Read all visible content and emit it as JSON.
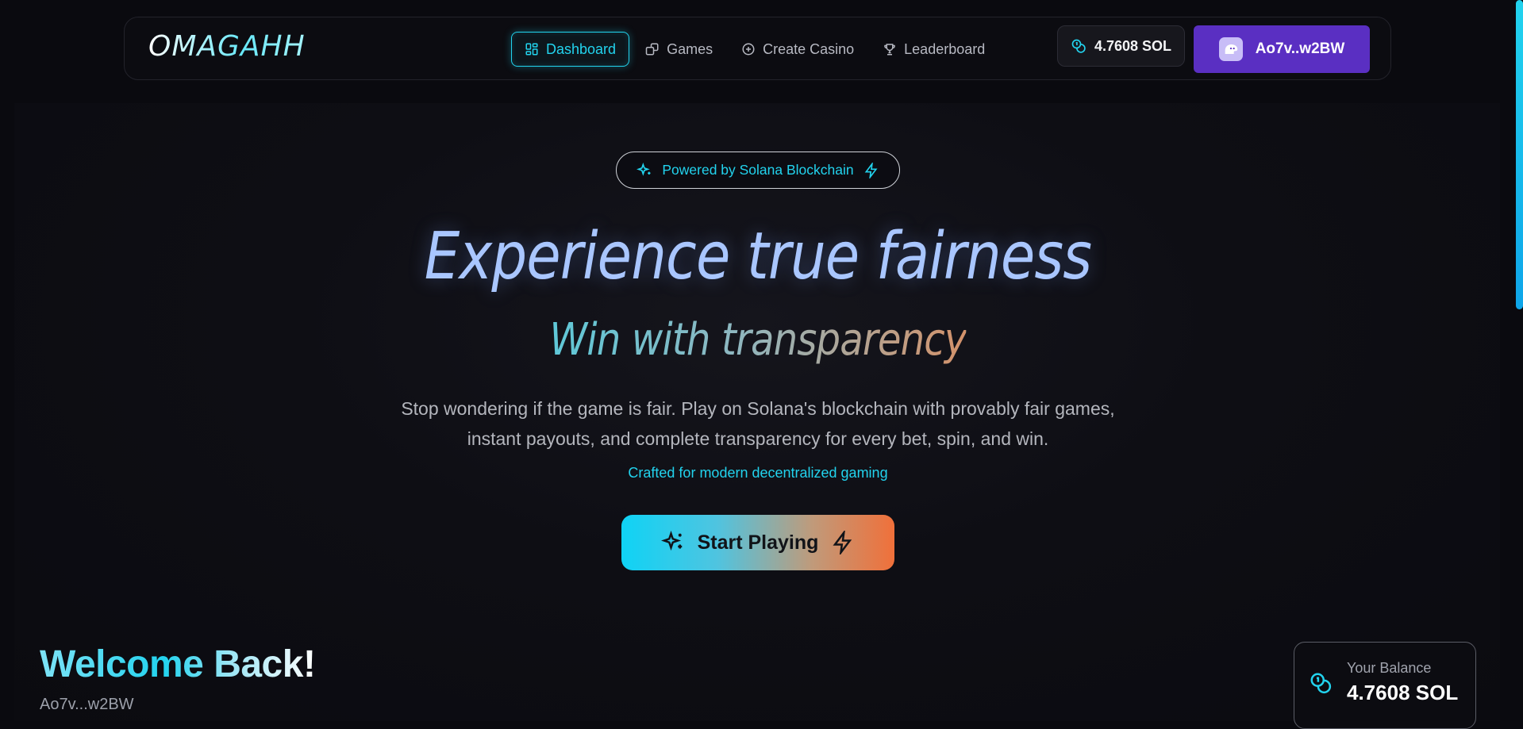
{
  "brand": {
    "logo": "OMAGAHH"
  },
  "nav": {
    "items": [
      {
        "label": "Dashboard",
        "icon": "dashboard-icon",
        "active": true
      },
      {
        "label": "Games",
        "icon": "dice-icon",
        "active": false
      },
      {
        "label": "Create Casino",
        "icon": "plus-circle-icon",
        "active": false
      },
      {
        "label": "Leaderboard",
        "icon": "trophy-icon",
        "active": false
      }
    ],
    "sol_balance": "4.7608 SOL",
    "wallet_label": "Ao7v..w2BW"
  },
  "hero": {
    "badge": "Powered by Solana Blockchain",
    "headline": "Experience true fairness",
    "subheadline": "Win with transparency",
    "description_line1": "Stop wondering if the game is fair. Play on Solana's blockchain with provably fair games,",
    "description_line2": "instant payouts, and complete transparency for every bet, spin, and win.",
    "tagline": "Crafted for modern decentralized gaming",
    "cta": "Start Playing"
  },
  "welcome": {
    "title": "Welcome Back!",
    "address": "Ao7v...w2BW",
    "balance_label": "Your Balance",
    "balance_value": "4.7608 SOL"
  },
  "colors": {
    "accent": "#22d3ee",
    "wallet_button": "#5a2fc2",
    "cta_start": "#0fd3f5",
    "cta_end": "#f0703a",
    "background": "#0a0a0f"
  }
}
